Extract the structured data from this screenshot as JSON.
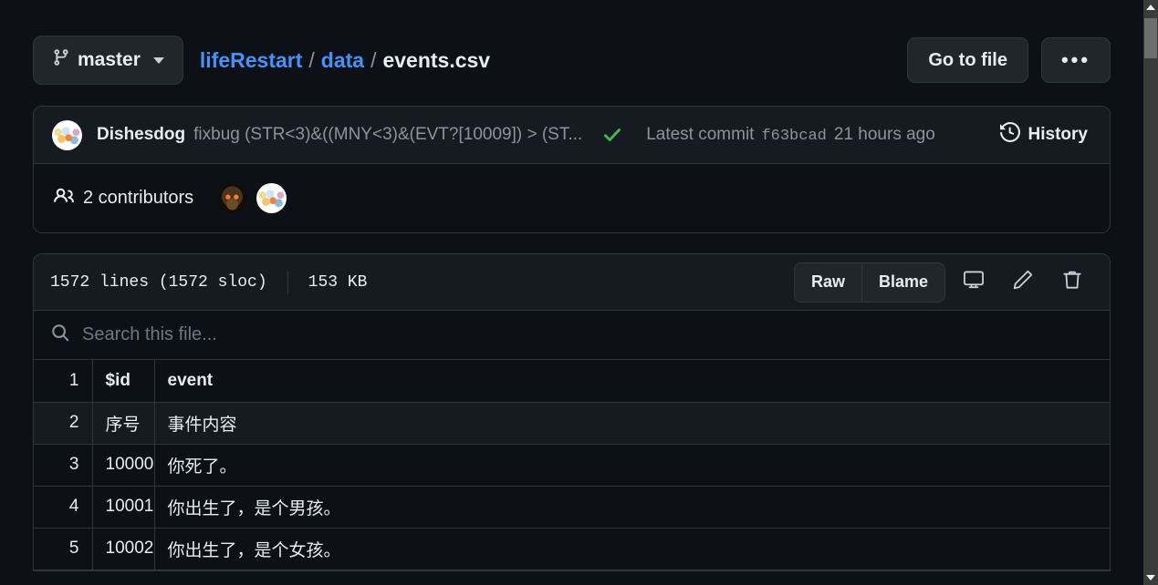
{
  "breadcrumb": {
    "branch": "master",
    "branch_icon": "git-branch-icon",
    "repo": "lifeRestart",
    "folder": "data",
    "file": "events.csv",
    "separator": "/"
  },
  "toolbar": {
    "go_to_file": "Go to file",
    "kebab": "•••"
  },
  "commit": {
    "author": "Dishesdog",
    "message": "fixbug (STR<3)&((MNY<3)&(EVT?[10009]) > (ST...",
    "status_icon": "check-icon",
    "latest_label": "Latest commit",
    "sha": "f63bcad",
    "time": "21 hours ago",
    "history_label": "History",
    "history_icon": "history-icon"
  },
  "contributors": {
    "icon": "people-icon",
    "label": "2 contributors",
    "avatars": [
      "owl-avatar",
      "cartoon-avatar"
    ]
  },
  "file": {
    "lines": "1572 lines (1572 sloc)",
    "size": "153 KB",
    "raw": "Raw",
    "blame": "Blame",
    "icons": [
      "monitor-icon",
      "pencil-icon",
      "trash-icon"
    ],
    "search_placeholder": "Search this file...",
    "search_icon": "search-icon",
    "search_value": ""
  },
  "table": {
    "columns": [
      "$id",
      "event"
    ],
    "rows": [
      {
        "n": "1",
        "id": "$id",
        "event": "event",
        "header": true,
        "alt": false
      },
      {
        "n": "2",
        "id": "序号",
        "event": "事件内容",
        "header": false,
        "alt": true
      },
      {
        "n": "3",
        "id": "10000",
        "event": "你死了。",
        "header": false,
        "alt": false
      },
      {
        "n": "4",
        "id": "10001",
        "event": "你出生了，是个男孩。",
        "header": false,
        "alt": false
      },
      {
        "n": "5",
        "id": "10002",
        "event": "你出生了，是个女孩。",
        "header": false,
        "alt": false
      }
    ]
  },
  "colors": {
    "background": "#0d1117",
    "panel": "#161b22",
    "border": "#30363d",
    "link": "#4493f8",
    "text": "#e6edf3",
    "muted": "#8b949e",
    "success": "#3fb950"
  }
}
